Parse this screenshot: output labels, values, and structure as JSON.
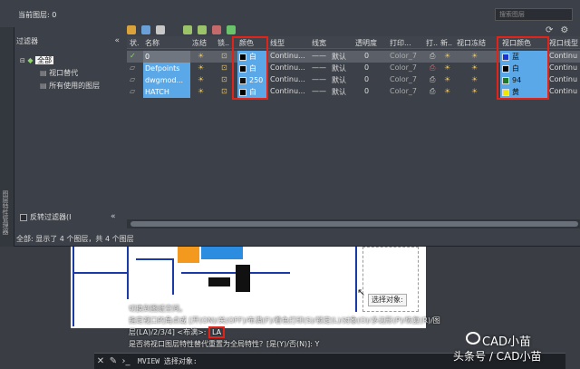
{
  "panel": {
    "current_layer": "当前图层: 0",
    "search_placeholder": "搜索图层",
    "side_strip_label": "图层特性管理器"
  },
  "filter": {
    "title": "过滤器",
    "collapse": "«",
    "tree": [
      {
        "label": "全部"
      },
      {
        "label": "视口替代"
      },
      {
        "label": "所有使用的图层"
      }
    ],
    "reverse_label": "反转过滤器(I",
    "reverse_collapse": "«"
  },
  "columns": [
    "状.",
    "名称",
    "冻结",
    "锁..",
    "颜色",
    "线型",
    "线宽",
    "透明度",
    "打印...",
    "打..",
    "新..",
    "视口冻结",
    "视口颜色",
    "视口线型"
  ],
  "layers": [
    {
      "name": "0",
      "color_label": "白",
      "color_hex": "#000000",
      "linetype": "Continu...",
      "lineweight": "默认",
      "transparency": "0",
      "plot_style": "Color_7",
      "vp_color_label": "蓝",
      "vp_color_hex": "#1a34d0",
      "vp_linetype": "Continu"
    },
    {
      "name": "Defpoints",
      "color_label": "白",
      "color_hex": "#000000",
      "linetype": "Continu...",
      "lineweight": "默认",
      "transparency": "0",
      "plot_style": "Color_7",
      "vp_color_label": "白",
      "vp_color_hex": "#000000",
      "vp_linetype": "Continu"
    },
    {
      "name": "dwgmod...",
      "color_label": "250",
      "color_hex": "#111111",
      "linetype": "Continu...",
      "lineweight": "默认",
      "transparency": "0",
      "plot_style": "Color_7",
      "vp_color_label": "94",
      "vp_color_hex": "#1e7a2a",
      "vp_linetype": "Continu"
    },
    {
      "name": "HATCH",
      "color_label": "白",
      "color_hex": "#000000",
      "linetype": "Continu...",
      "lineweight": "默认",
      "transparency": "0",
      "plot_style": "Color_7",
      "vp_color_label": "黄",
      "vp_color_hex": "#f2e600",
      "vp_linetype": "Continu"
    }
  ],
  "lineweight_dash": "——",
  "status": "全部: 显示了 4 个图层，共 4 个图层",
  "drawing": {
    "tooltip": "选择对象:"
  },
  "command": {
    "history": [
      "切换到图纸空间。",
      "指定视口的角点或 [开(ON)/关(OFF)/布满(F)/着色打印(S)/锁定(L)/对象(O)/多边形(P)/恢复(R)/图",
      "层(LA)/2/3/4] <布满>:",
      "是否将视口图层特性替代重置为全局特性？[是(Y)/否(N)]: Y"
    ],
    "la_value": "LA",
    "prompt": "MVIEW 选择对象:"
  },
  "watermark": {
    "line1": "CAD小苗",
    "line2": "头条号 / CAD小苗"
  },
  "colors": {
    "highlight_blue": "#5aa8e8",
    "annotation_red": "#e2231a",
    "panel_bg": "#3c4048"
  }
}
